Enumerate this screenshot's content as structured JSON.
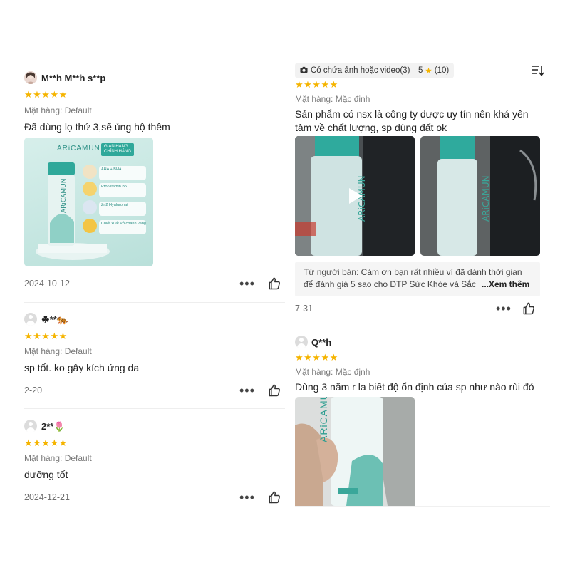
{
  "left_reviews": [
    {
      "username": "M**h M**h s**p",
      "stars": "★★★★★",
      "variant": "Mặt hàng: Default",
      "text": "Đã dùng lọ thứ 3,sẽ ủng hộ thêm",
      "date": "2024-10-12",
      "image": {
        "brand": "ARiCAMUN",
        "badge_line1": "GIAN HÀNG",
        "badge_line2": "CHÍNH HÃNG",
        "ingredients": [
          "AHA + BHA",
          "Pro-vitamin B5",
          "Zn2 Hyaluronat",
          "Chiết xuất Vỏ chanh vàng"
        ]
      }
    },
    {
      "username": "☘**🐅",
      "stars": "★★★★★",
      "variant": "Mặt hàng: Default",
      "text": "sp tốt. ko gây kích ứng da",
      "date": "2-20"
    },
    {
      "username": "2**🌷",
      "stars": "★★★★★",
      "variant": "Mặt hàng: Default",
      "text": "dưỡng tốt",
      "date": "2024-12-21"
    }
  ],
  "filters": {
    "media_filter": "Có chứa ảnh hoặc video(3)",
    "rating_filter_value": "5",
    "rating_filter_count": "(10)",
    "star": "★"
  },
  "right_reviews": [
    {
      "stars": "★★★★★",
      "variant": "Mặt hàng: Mặc định",
      "text": "Sản phẩm có nsx là công ty dược uy tín nên khá yên tâm về chất lượng, sp dùng đất ok",
      "seller_label": "Từ người bán:",
      "seller_reply": " Cảm ơn bạn rất nhiều vì đã dành thời gian để đánh giá 5 sao cho DTP Sức Khỏe và Sắc",
      "see_more": "...Xem thêm",
      "date": "7-31"
    },
    {
      "username": "Q**h",
      "stars": "★★★★★",
      "variant": "Mặt hàng: Mặc định",
      "text": "Dùng 3 năm r la biết độ ổn định của sp như nào rùi đó",
      "image_brand": "ARiCAMUN"
    }
  ],
  "icons": {
    "more": "•••",
    "star_color": "#f5b400",
    "accent_teal": "#3fb5a8"
  }
}
